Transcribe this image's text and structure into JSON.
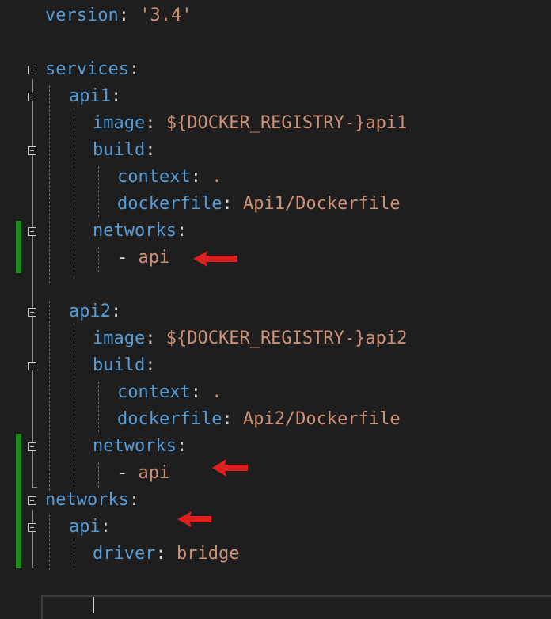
{
  "editor": {
    "lines": [
      {
        "key": "version",
        "colon": ": ",
        "value": "'3.4'"
      },
      {
        "key": "services",
        "colon": ":"
      },
      {
        "key": "api1",
        "colon": ":"
      },
      {
        "key": "image",
        "colon": ": ",
        "value": "${DOCKER_REGISTRY-}api1"
      },
      {
        "key": "build",
        "colon": ":"
      },
      {
        "key": "context",
        "colon": ": ",
        "value": "."
      },
      {
        "key": "dockerfile",
        "colon": ": ",
        "value": "Api1/Dockerfile"
      },
      {
        "key": "networks",
        "colon": ":"
      },
      {
        "dash": "- ",
        "value": "api"
      },
      {
        "key": "api2",
        "colon": ":"
      },
      {
        "key": "image",
        "colon": ": ",
        "value": "${DOCKER_REGISTRY-}api2"
      },
      {
        "key": "build",
        "colon": ":"
      },
      {
        "key": "context",
        "colon": ": ",
        "value": "."
      },
      {
        "key": "dockerfile",
        "colon": ": ",
        "value": "Api2/Dockerfile"
      },
      {
        "key": "networks",
        "colon": ":"
      },
      {
        "dash": "- ",
        "value": "api"
      },
      {
        "key": "networks",
        "colon": ":"
      },
      {
        "key": "api",
        "colon": ":"
      },
      {
        "key": "driver",
        "colon": ": ",
        "value": "bridge"
      }
    ]
  },
  "colors": {
    "background": "#1e1e1e",
    "key": "#569cd6",
    "string": "#ce9178",
    "punctuation": "#d4d4d4",
    "change_bar": "#1e8a1e",
    "annotation_arrow": "#e02020"
  },
  "icons": {
    "fold_toggle": "collapse-minus-icon",
    "annotation": "red-arrow-left-icon"
  }
}
